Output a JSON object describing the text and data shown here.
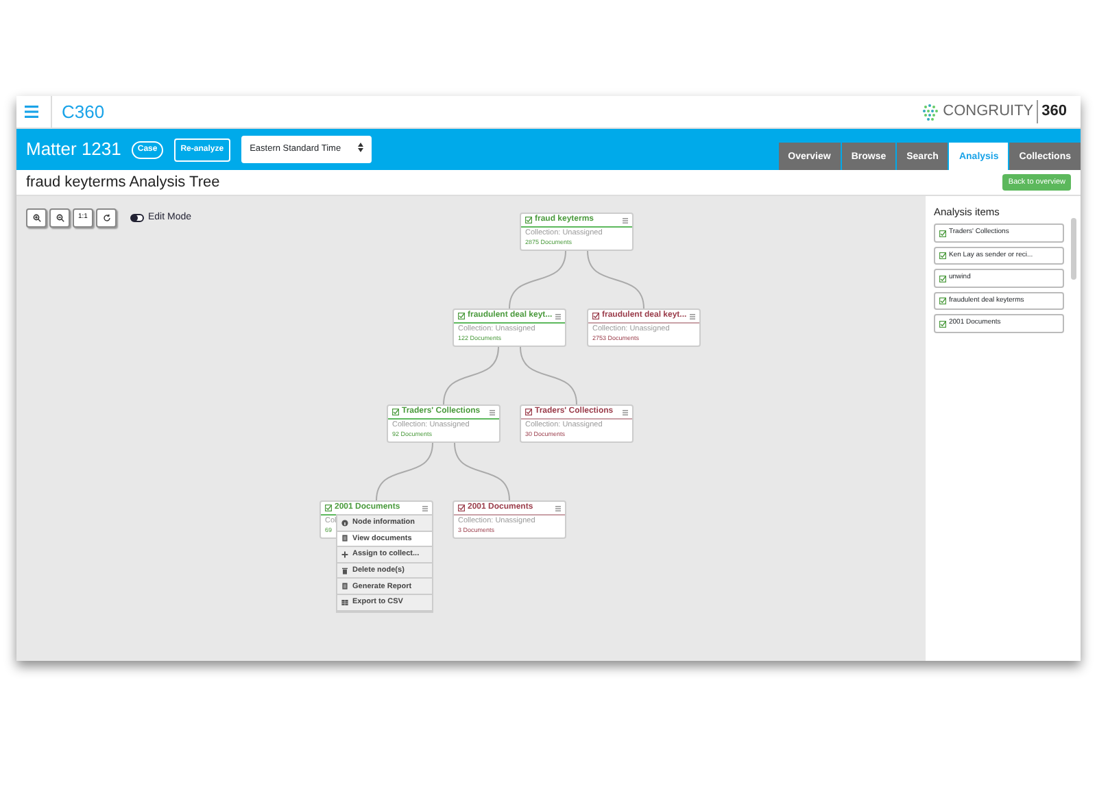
{
  "app": {
    "title": "C360",
    "logo_text": "CONGRUITY",
    "logo_number": "360"
  },
  "header": {
    "matter": "Matter 1231",
    "badge": "Case",
    "reanalyze": "Re-analyze",
    "timezone": "Eastern Standard Time"
  },
  "tabs": [
    {
      "label": "Overview",
      "selected": false
    },
    {
      "label": "Browse",
      "selected": false
    },
    {
      "label": "Search",
      "selected": false
    },
    {
      "label": "Analysis",
      "selected": true
    },
    {
      "label": "Collections",
      "selected": false
    }
  ],
  "page_title": "fraud keyterms Analysis Tree",
  "back_button": "Back to overview",
  "toolbar": {
    "buttons": [
      {
        "kind": "zoom-in"
      },
      {
        "kind": "zoom-out"
      },
      {
        "kind": "reset",
        "label": "1:1"
      },
      {
        "kind": "refresh"
      }
    ],
    "edit_mode": {
      "label": "Edit Mode",
      "on": false
    }
  },
  "tree": {
    "title": "fraud keyterms",
    "included": true,
    "collection": "Collection: Unassigned",
    "count": "2875 Documents",
    "children": [
      {
        "title": "fraudulent deal keyt...",
        "included": true,
        "collection": "Collection: Unassigned",
        "count": "122 Documents",
        "children": [
          {
            "title": "Traders' Collections",
            "included": true,
            "collection": "Collection: Unassigned",
            "count": "92 Documents",
            "children": [
              {
                "title": "2001 Documents",
                "included": true,
                "collection": "Col",
                "count": "69"
              },
              {
                "title": "2001 Documents",
                "included": false,
                "collection": "Collection: Unassigned",
                "count": "3 Documents"
              }
            ]
          },
          {
            "title": "Traders' Collections",
            "included": false,
            "collection": "Collection: Unassigned",
            "count": "30 Documents"
          }
        ]
      },
      {
        "title": "fraudulent deal keyt...",
        "included": false,
        "collection": "Collection: Unassigned",
        "count": "2753 Documents"
      }
    ]
  },
  "context_menu": [
    {
      "label": "Node information",
      "kind": "info",
      "selected": false
    },
    {
      "label": "View documents",
      "kind": "doc",
      "selected": true
    },
    {
      "label": "Assign to collect...",
      "kind": "plus",
      "selected": false
    },
    {
      "label": "Delete node(s)",
      "kind": "trash",
      "selected": false
    },
    {
      "label": "Generate Report",
      "kind": "doc",
      "selected": false
    },
    {
      "label": "Export to CSV",
      "kind": "table",
      "selected": false
    }
  ],
  "sidebar": {
    "title": "Analysis items",
    "items": [
      {
        "label": "Traders' Collections",
        "checked": true
      },
      {
        "label": "Ken Lay as sender or reci...",
        "checked": true
      },
      {
        "label": "unwind",
        "checked": true
      },
      {
        "label": "fraudulent deal keyterms",
        "checked": true
      },
      {
        "label": "2001 Documents",
        "checked": true
      }
    ]
  }
}
